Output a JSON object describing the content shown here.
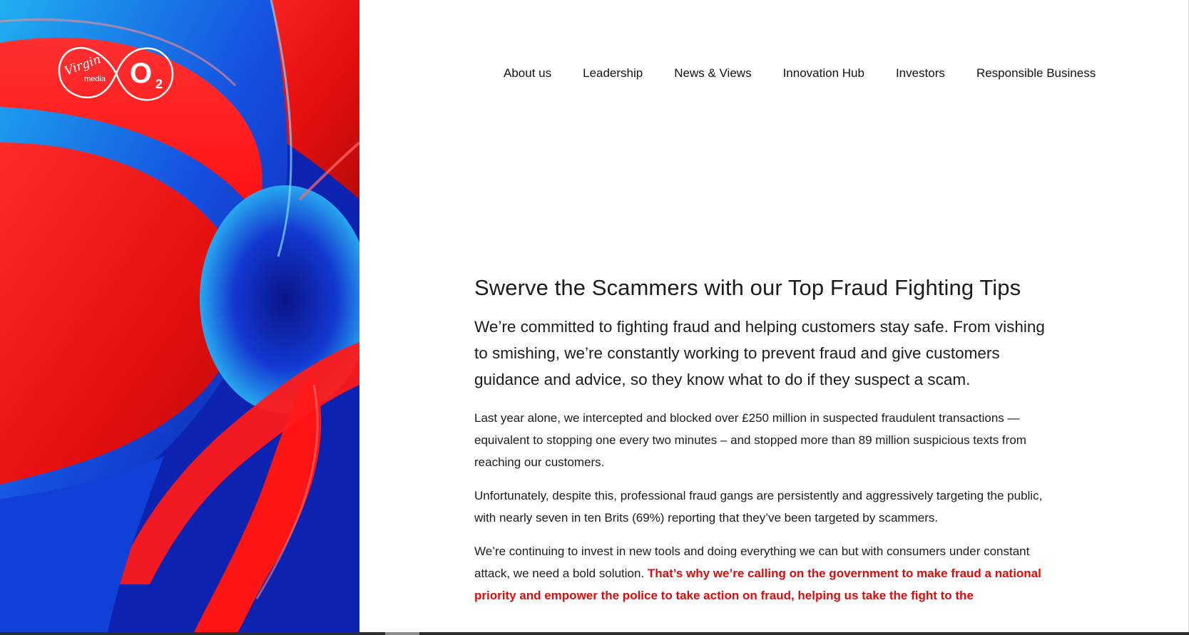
{
  "brand": {
    "logo_text_virgin": "Virgin",
    "logo_text_media": "media",
    "logo_text_o2": "O",
    "logo_text_o2_sub": "2",
    "colors": {
      "red": "#ff1a1a",
      "blue": "#0a1fa8",
      "light_blue": "#18a0e8"
    }
  },
  "nav": {
    "items": [
      {
        "label": "About us"
      },
      {
        "label": "Leadership"
      },
      {
        "label": "News & Views"
      },
      {
        "label": "Innovation Hub"
      },
      {
        "label": "Investors"
      },
      {
        "label": "Responsible Business"
      }
    ]
  },
  "article": {
    "title": "Swerve the Scammers with our Top Fraud Fighting Tips",
    "lead": "We’re committed to fighting fraud and helping customers stay safe. From vishing to smishing, we’re constantly working to prevent fraud and give customers guidance and advice, so they know what to do if they suspect a scam.",
    "p1": "Last year alone, we intercepted and blocked over £250 million in suspected fraudulent transactions — equivalent to stopping one every two minutes – and stopped more than 89 million suspicious texts from reaching our customers.",
    "p2": "Unfortunately, despite this, professional fraud gangs are persistently and aggressively targeting the public, with nearly seven in ten Brits (69%) reporting that they’ve been targeted by scammers.",
    "p3_plain": "We’re continuing to invest in new tools and doing everything we can but with consumers under constant attack, we need a bold solution. ",
    "p3_highlight": "That’s why we’re calling on the government to make fraud a national priority and empower the police to take action on fraud, helping us take the fight to the"
  }
}
